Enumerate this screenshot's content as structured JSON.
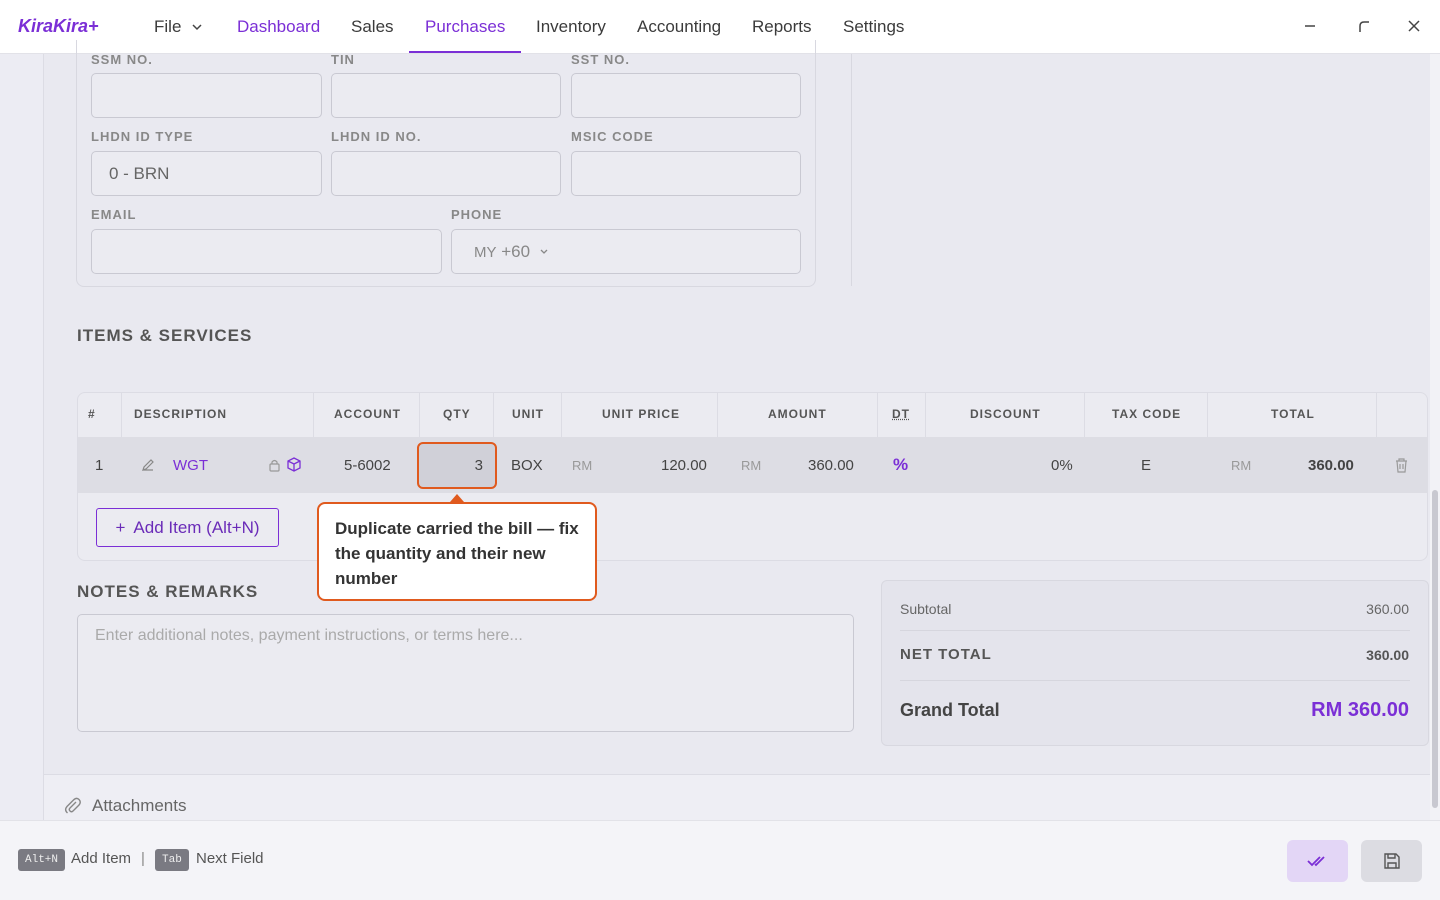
{
  "app": {
    "brand": "KiraKira+"
  },
  "nav": {
    "file": "File",
    "dashboard": "Dashboard",
    "sales": "Sales",
    "purchases": "Purchases",
    "inventory": "Inventory",
    "accounting": "Accounting",
    "reports": "Reports",
    "settings": "Settings"
  },
  "supplier_form": {
    "ssm_label": "SSM NO.",
    "tin_label": "TIN",
    "sst_label": "SST NO.",
    "lhdn_type_label": "LHDN ID TYPE",
    "lhdn_type_value": "0 - BRN",
    "lhdn_no_label": "LHDN ID NO.",
    "msic_label": "MSIC CODE",
    "email_label": "EMAIL",
    "phone_label": "PHONE",
    "phone_country": "MY",
    "phone_code": "+60"
  },
  "items": {
    "title": "ITEMS & SERVICES",
    "headers": {
      "num": "#",
      "description": "DESCRIPTION",
      "account": "ACCOUNT",
      "qty": "QTY",
      "unit": "UNIT",
      "unit_price": "UNIT PRICE",
      "amount": "AMOUNT",
      "dt": "DT",
      "discount": "DISCOUNT",
      "tax_code": "TAX CODE",
      "total": "TOTAL"
    },
    "rows": [
      {
        "num": "1",
        "description": "WGT",
        "account": "5-6002",
        "qty": "3",
        "unit": "BOX",
        "currency": "RM",
        "unit_price": "120.00",
        "amount": "360.00",
        "dt": "%",
        "discount": "0%",
        "tax_code": "E",
        "total": "360.00"
      }
    ],
    "add_label": "Add Item (Alt+N)"
  },
  "callout": {
    "text": "Duplicate carried the bill — fix the quantity and their new number"
  },
  "notes": {
    "title": "NOTES & REMARKS",
    "placeholder": "Enter additional notes, payment instructions, or terms here..."
  },
  "totals": {
    "subtotal_label": "Subtotal",
    "subtotal_value": "360.00",
    "net_label": "NET TOTAL",
    "net_value": "360.00",
    "grand_label": "Grand Total",
    "grand_value": "RM 360.00"
  },
  "attachments": {
    "label": "Attachments"
  },
  "footer": {
    "key_add": "Alt+N",
    "hint_add": "Add Item",
    "separator": "|",
    "key_tab": "Tab",
    "hint_tab": "Next Field"
  },
  "colors": {
    "accent": "#7b2fd6",
    "callout_border": "#e05a1e"
  }
}
